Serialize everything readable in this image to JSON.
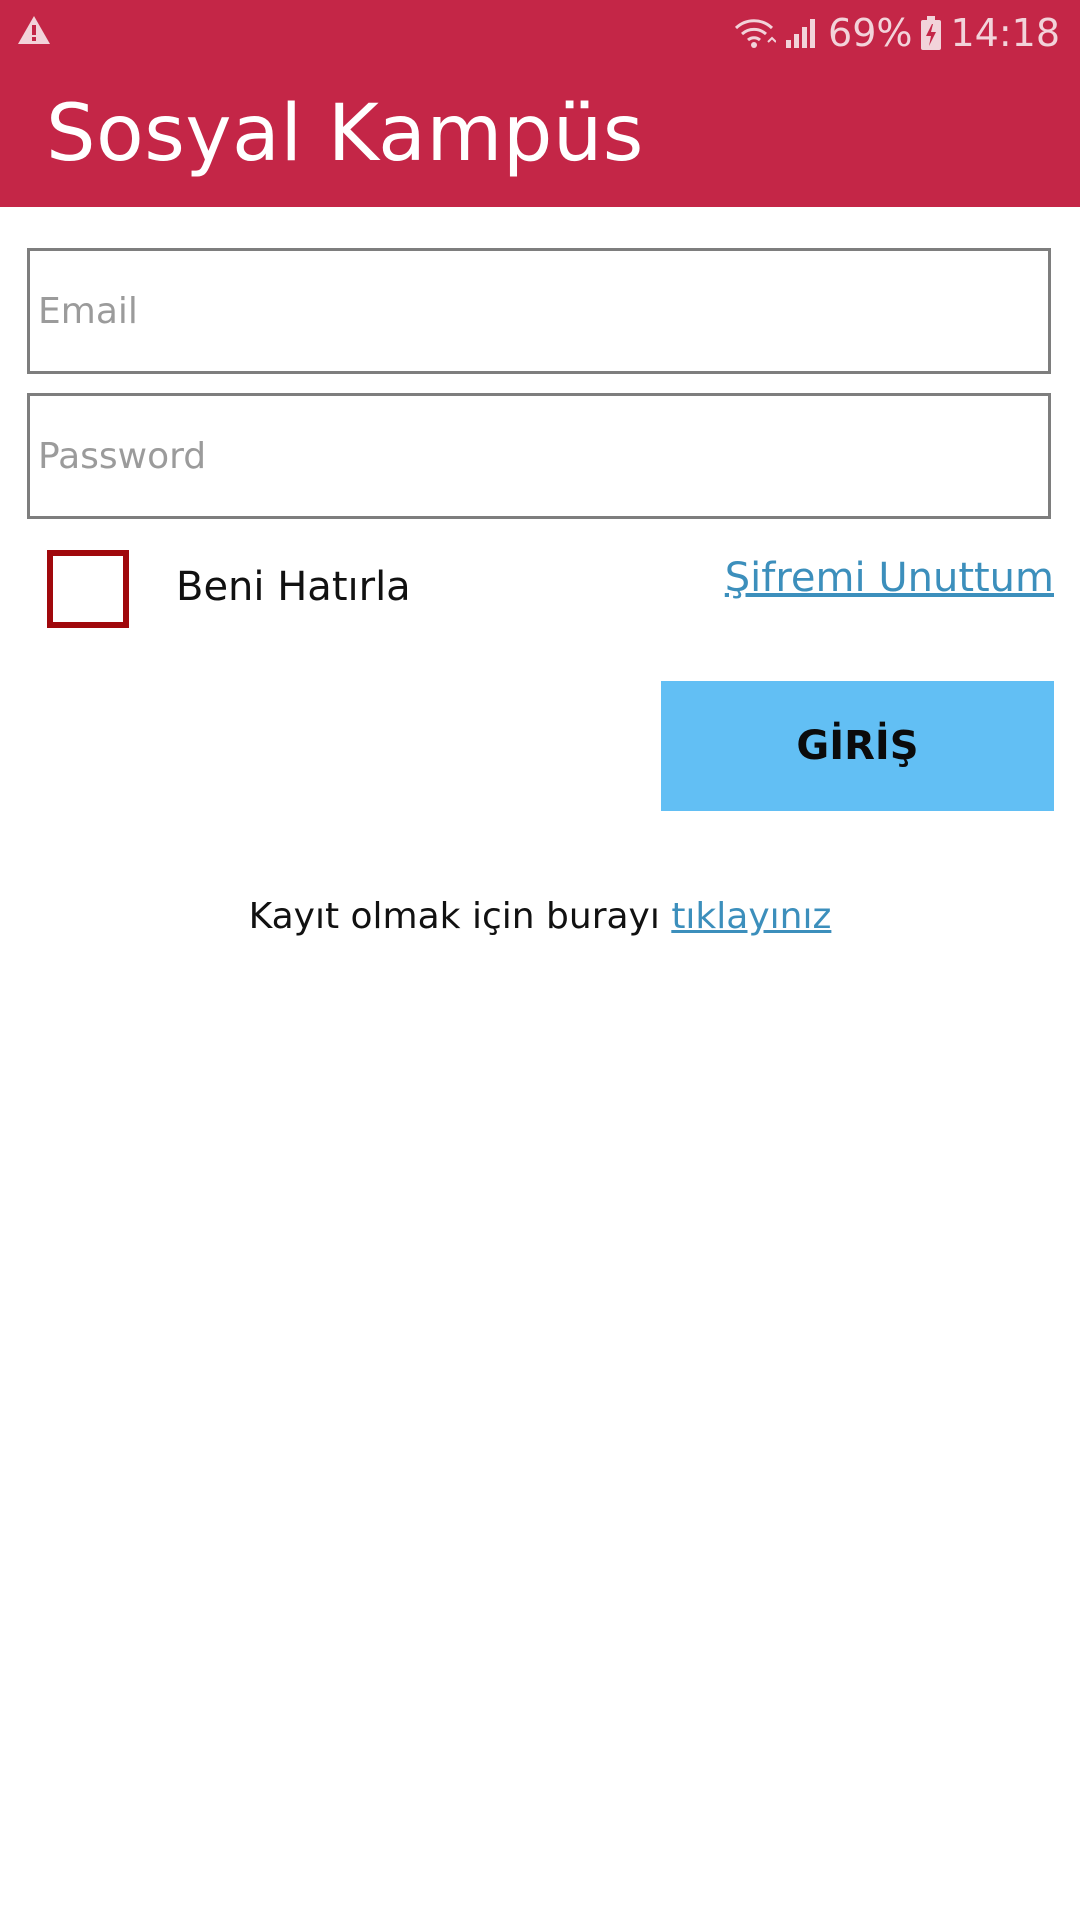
{
  "status_bar": {
    "battery": "69%",
    "time": "14:18",
    "icons": [
      "warning-icon",
      "wifi-icon",
      "signal-icon",
      "battery-charging-icon"
    ]
  },
  "app": {
    "title": "Sosyal Kampüs",
    "brand_color": "#c42647"
  },
  "form": {
    "email_placeholder": "Email",
    "password_placeholder": "Password",
    "remember_label": "Beni Hatırla",
    "remember_checked": false,
    "forgot_link": "Şifremi Unuttum",
    "login_button": "GİRİŞ",
    "login_button_color": "#62bff4"
  },
  "register": {
    "prefix": "Kayıt olmak için burayı ",
    "link": "tıklayınız"
  }
}
